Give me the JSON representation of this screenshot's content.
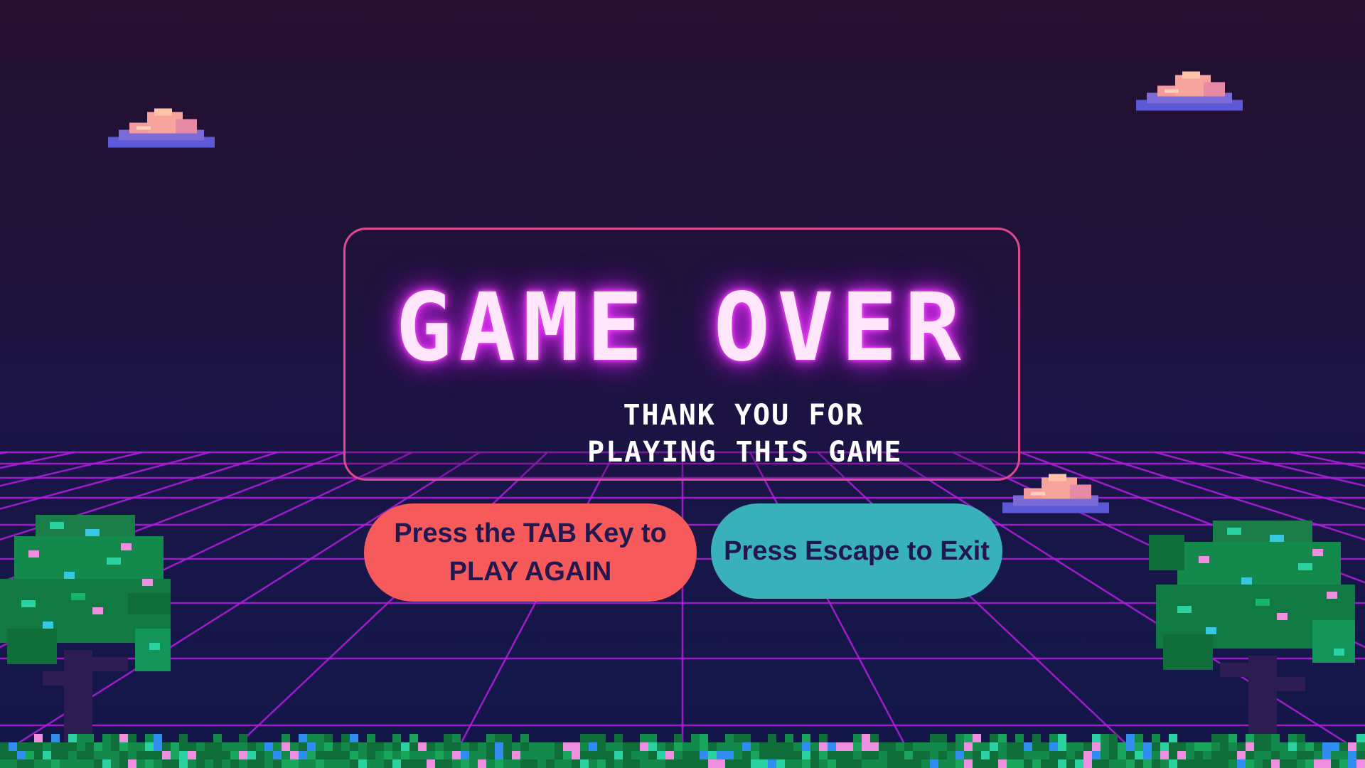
{
  "screen": {
    "title": "GAME OVER",
    "subtitle_line1": "THANK YOU FOR",
    "subtitle_line2": "PLAYING THIS GAME"
  },
  "buttons": {
    "play_again_line1": "Press the TAB Key to",
    "play_again_line2": "PLAY AGAIN",
    "exit_label": "Press Escape to Exit"
  },
  "colors": {
    "background_top": "#24102f",
    "background_bottom": "#14164a",
    "grid_line": "#b41ee0",
    "panel_border": "#e0488f",
    "title_glow": "#e33bf5",
    "play_again_button": "#f75a5a",
    "exit_button": "#38b1bb",
    "button_text": "#22184f"
  },
  "icons": [
    "cloud-icon",
    "tree-icon",
    "pixel-grass"
  ]
}
